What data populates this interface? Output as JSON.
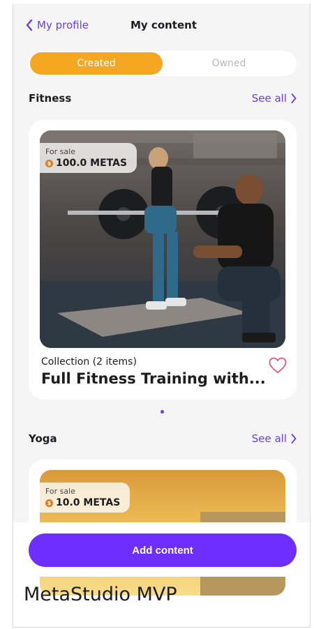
{
  "header": {
    "back_label": "My profile",
    "title": "My content"
  },
  "tabs": {
    "active": "Created",
    "inactive": "Owned"
  },
  "sections": [
    {
      "title": "Fitness",
      "see_all": "See all",
      "card": {
        "sale_label": "For sale",
        "price": "100.0 METAS",
        "coin_symbol": "$",
        "collection": "Collection (2 items)",
        "title": "Full Fitness Training with...",
        "image": "fitness-photo"
      }
    },
    {
      "title": "Yoga",
      "see_all": "See all",
      "card": {
        "sale_label": "For sale",
        "price": "10.0 METAS",
        "coin_symbol": "$",
        "image": "yoga-sunset-photo"
      }
    }
  ],
  "carousel": {
    "count": 1,
    "active": 1
  },
  "actions": {
    "add_content": "Add content"
  },
  "footer": {
    "app_name": "MetaStudio MVP"
  },
  "colors": {
    "accent": "#6a3de8",
    "button": "#6d2fff",
    "tab_active": "#f5a623",
    "heart": "#e05a7a"
  }
}
